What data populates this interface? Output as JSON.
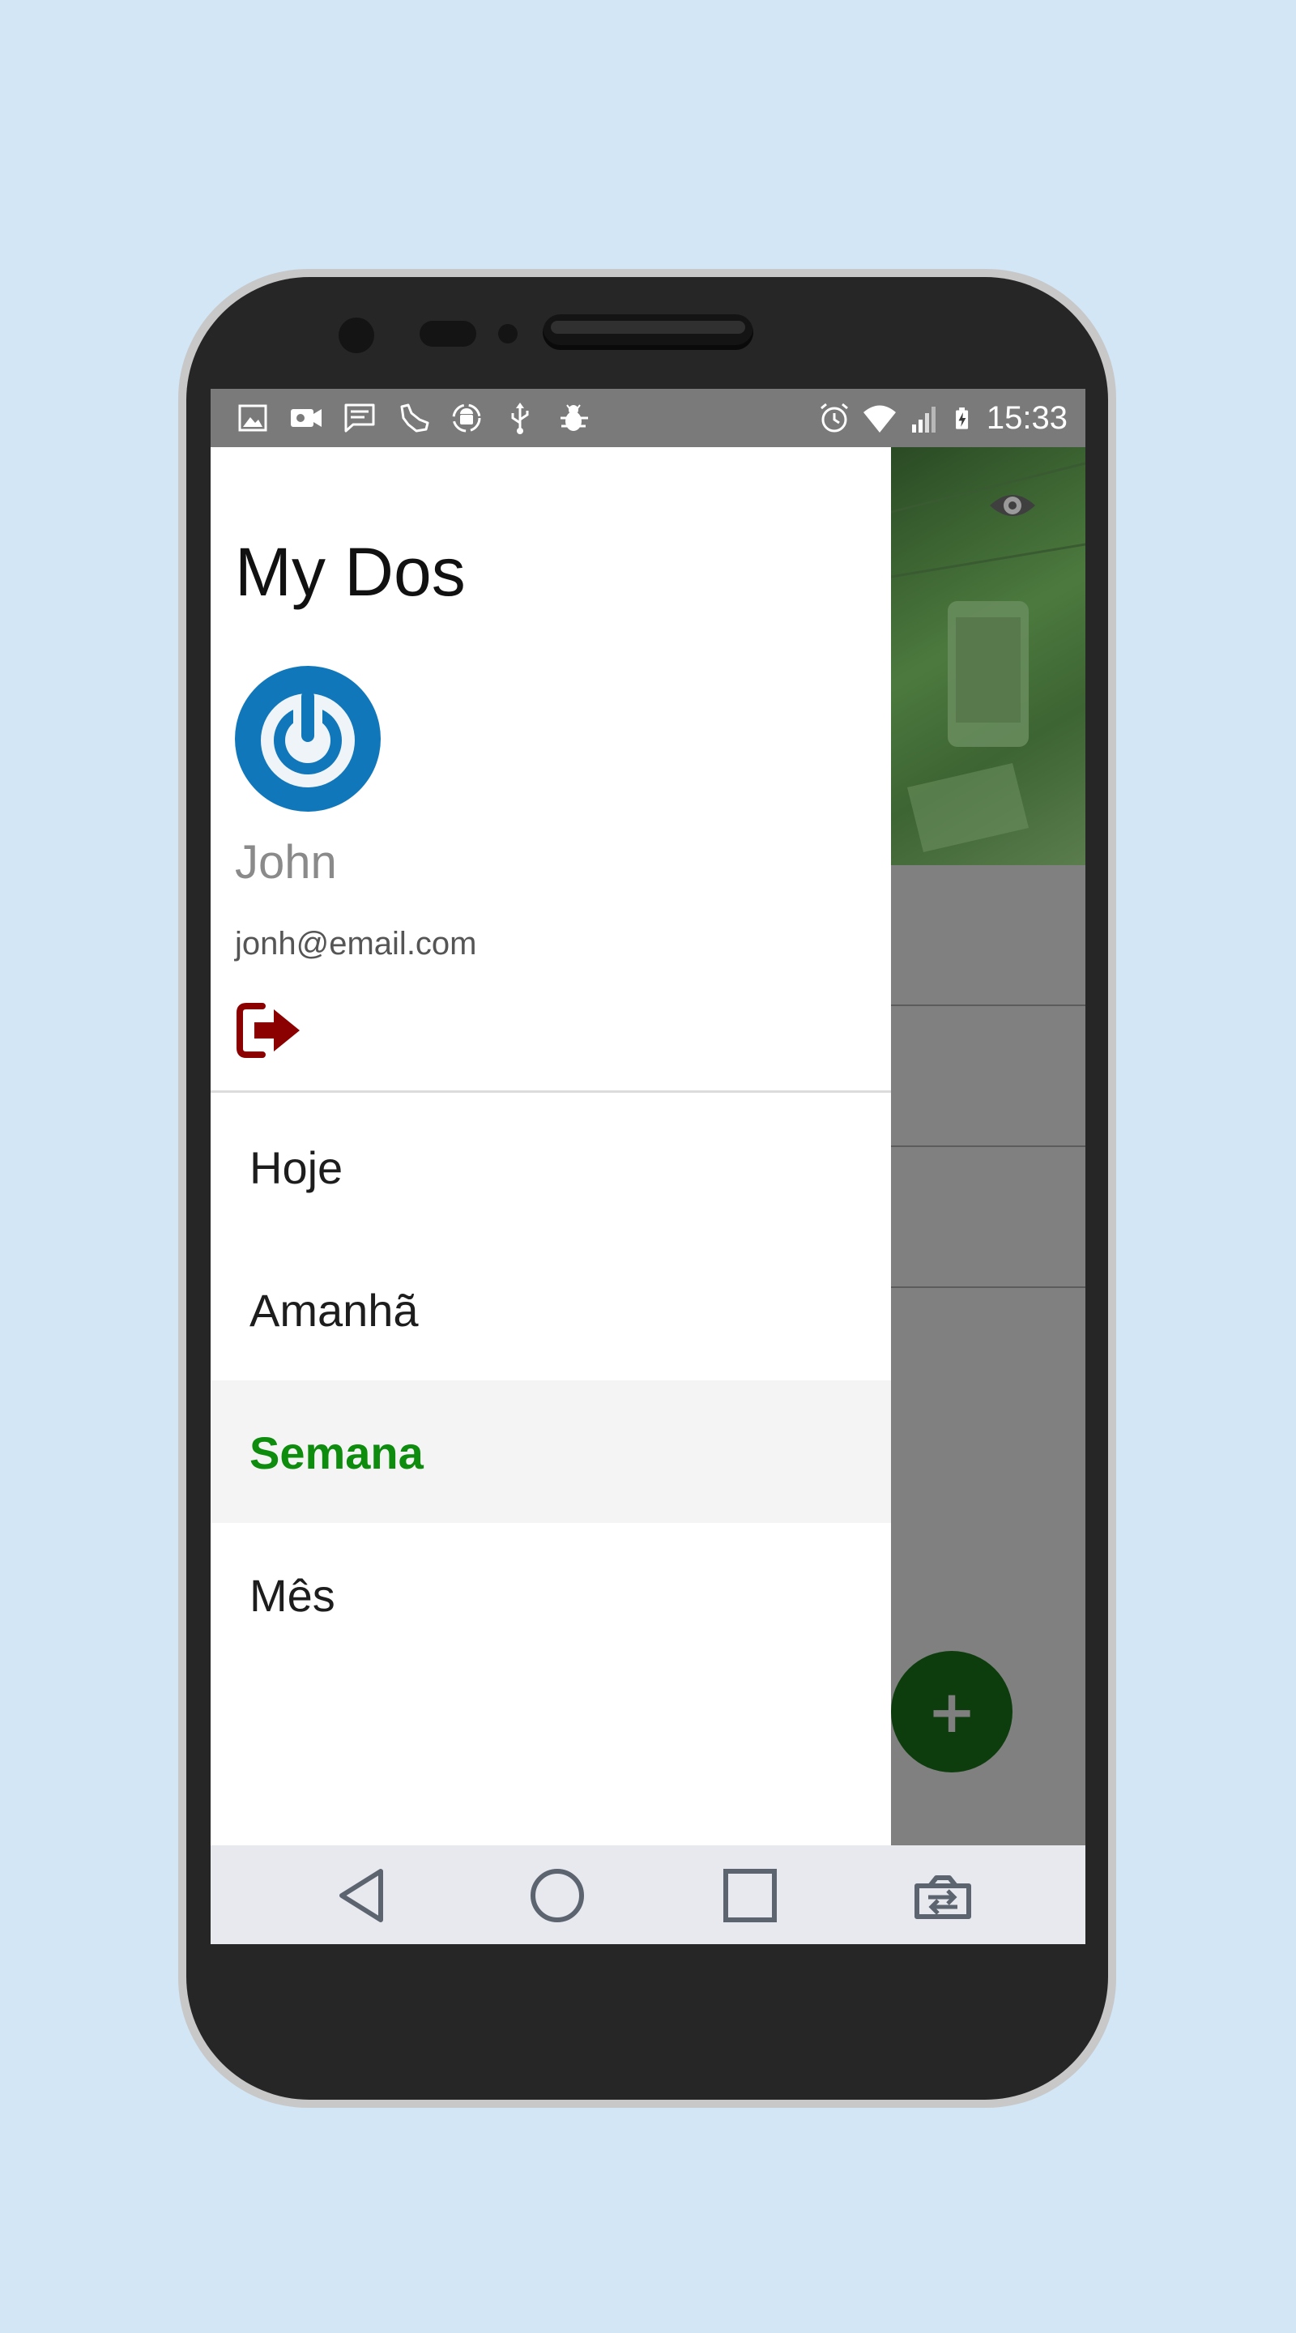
{
  "status_bar": {
    "time": "15:33",
    "left_icons": [
      "gallery-icon",
      "video-camera-icon",
      "message-icon",
      "fitness-shoe-icon",
      "android-sync-icon",
      "usb-icon",
      "bug-icon"
    ],
    "right_icons": [
      "alarm-icon",
      "wifi-icon",
      "cell-signal-icon",
      "battery-charging-icon"
    ]
  },
  "drawer": {
    "title": "My Dos",
    "user": {
      "name": "John",
      "email": "jonh@email.com"
    },
    "logout_icon": "sign-out-icon",
    "menu": [
      {
        "label": "Hoje",
        "selected": false
      },
      {
        "label": "Amanhã",
        "selected": false
      },
      {
        "label": "Semana",
        "selected": true
      },
      {
        "label": "Mês",
        "selected": false
      }
    ]
  },
  "background_app": {
    "fab_label": "+",
    "header_icon": "eye-icon"
  },
  "nav_bar": {
    "buttons": [
      "back-icon",
      "home-icon",
      "recents-icon",
      "screen-switch-icon"
    ]
  },
  "colors": {
    "page_background": "#d2e6f6",
    "status_bar": "#7a7a7a",
    "accent_selected": "#0d8c0d",
    "fab": "#0d3d0d",
    "avatar": "#1177bb",
    "logout": "#8b0000"
  }
}
